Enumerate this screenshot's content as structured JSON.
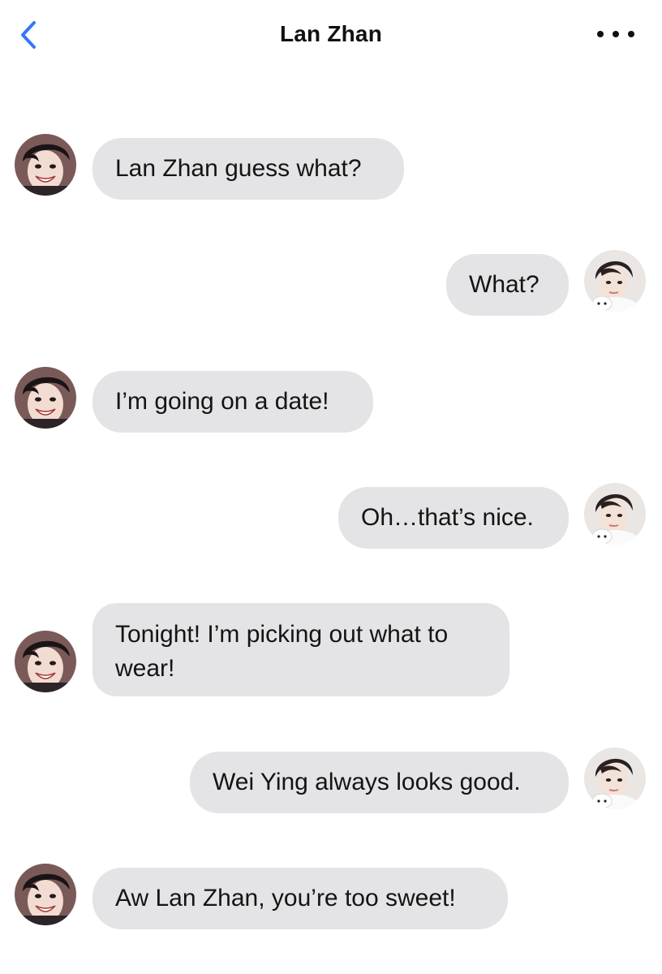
{
  "header": {
    "title": "Lan Zhan",
    "back_icon": "chevron-left-icon",
    "more_icon": "more-horizontal-icon",
    "accent": "#3478f6"
  },
  "colors": {
    "bubble": "#e4e4e6",
    "background": "#ffffff"
  },
  "messages": [
    {
      "sender": "Wei Ying",
      "side": "left",
      "text": "Lan Zhan guess what?"
    },
    {
      "sender": "Lan Zhan",
      "side": "right",
      "text": "What?"
    },
    {
      "sender": "Wei Ying",
      "side": "left",
      "text": "I’m going on a date!"
    },
    {
      "sender": "Lan Zhan",
      "side": "right",
      "text": "Oh…that’s nice."
    },
    {
      "sender": "Wei Ying",
      "side": "left",
      "text": "Tonight! I’m picking out what to wear!"
    },
    {
      "sender": "Lan Zhan",
      "side": "right",
      "text": "Wei Ying always looks good."
    },
    {
      "sender": "Wei Ying",
      "side": "left",
      "text": "Aw Lan Zhan, you’re too sweet!"
    }
  ]
}
